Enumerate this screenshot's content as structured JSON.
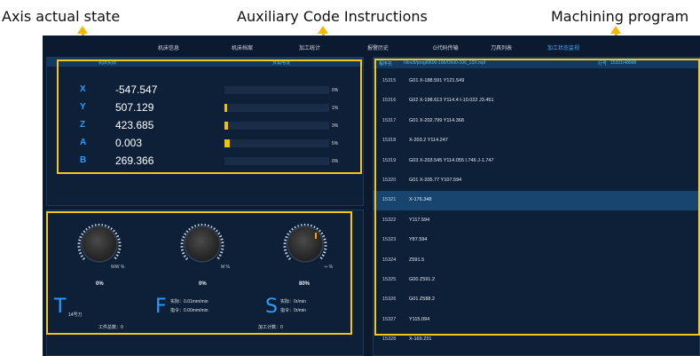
{
  "annotations": {
    "axis_state": "Axis actual state",
    "aux_code": "Auxiliary Code Instructions",
    "program": "Machining program"
  },
  "menu": [
    {
      "label": "机床信息",
      "active": false
    },
    {
      "label": "机床档案",
      "active": false
    },
    {
      "label": "加工统计",
      "active": false
    },
    {
      "label": "报警历史",
      "active": false
    },
    {
      "label": "G代码传输",
      "active": false
    },
    {
      "label": "刀具列表",
      "active": false
    },
    {
      "label": "加工状态监视",
      "active": true
    }
  ],
  "axis_panel": {
    "header_left": "机床实际",
    "header_right": "负载电流",
    "axes": [
      {
        "name": "X",
        "value": "-547.547",
        "load_pct": "0%",
        "load": 0.0
      },
      {
        "name": "Y",
        "value": "507.129",
        "load_pct": "1%",
        "load": 0.01
      },
      {
        "name": "Z",
        "value": "423.685",
        "load_pct": "3%",
        "load": 0.03
      },
      {
        "name": "A",
        "value": "0.003",
        "load_pct": "5%",
        "load": 0.05
      },
      {
        "name": "B",
        "value": "269.366",
        "load_pct": "0%",
        "load": 0.0
      }
    ]
  },
  "aux_panel": {
    "knobs": [
      {
        "name": "rapid-override",
        "pct": "0%",
        "unit": "WW %",
        "level": 0.0
      },
      {
        "name": "feed-override",
        "pct": "0%",
        "unit": "M %",
        "level": 0.0
      },
      {
        "name": "spindle-override",
        "pct": "80%",
        "unit": "⇒ %",
        "level": 0.8
      }
    ],
    "t_letter": "T",
    "t_value": "14号刀",
    "f_letter": "F",
    "f_actual": "实际：0.01mm/min",
    "f_command": "指令：0.00mm/min",
    "s_letter": "S",
    "s_actual": "实际：0r/min",
    "s_command": "指令：0r/min",
    "workpiece_total": "工件总数：0",
    "processed_count": "加工计数：0"
  },
  "program_panel": {
    "file_label": "程序名",
    "file_path": "h/lnc8/prog/0600-106/O600-106_13X.mpf",
    "line_label": "行号",
    "line_value": "15321/48998",
    "highlight_line": "15321",
    "lines": [
      {
        "num": "15315",
        "code": "G01 X-188.591 Y121.549"
      },
      {
        "num": "15316",
        "code": "G02 X-198.613 Y114.4 I-10.022 J3.451"
      },
      {
        "num": "15317",
        "code": "G01 X-202.799 Y114.368"
      },
      {
        "num": "15318",
        "code": "X-203.2 Y114.247"
      },
      {
        "num": "15319",
        "code": "G03 X-203.545 Y114.055 I.746 J-1.747"
      },
      {
        "num": "15320",
        "code": "G01 X-205.77 Y107.594"
      },
      {
        "num": "15321",
        "code": "X-176.348"
      },
      {
        "num": "15322",
        "code": "Y117.594"
      },
      {
        "num": "15323",
        "code": "Y87.594"
      },
      {
        "num": "15324",
        "code": "Z591.5"
      },
      {
        "num": "15325",
        "code": "G00 Z591.2"
      },
      {
        "num": "15326",
        "code": "G01 Z588.2"
      },
      {
        "num": "15327",
        "code": "Y115.094"
      },
      {
        "num": "15328",
        "code": "X-169.231"
      },
      {
        "num": "15329",
        "code": "G02 X-170.6 Y122. I16.731 J6.906"
      }
    ]
  },
  "colors": {
    "accent_yellow": "#f5c518",
    "axis_blue": "#2f9bff",
    "background": "#0c1a30",
    "highlight_row": "#17456f"
  }
}
